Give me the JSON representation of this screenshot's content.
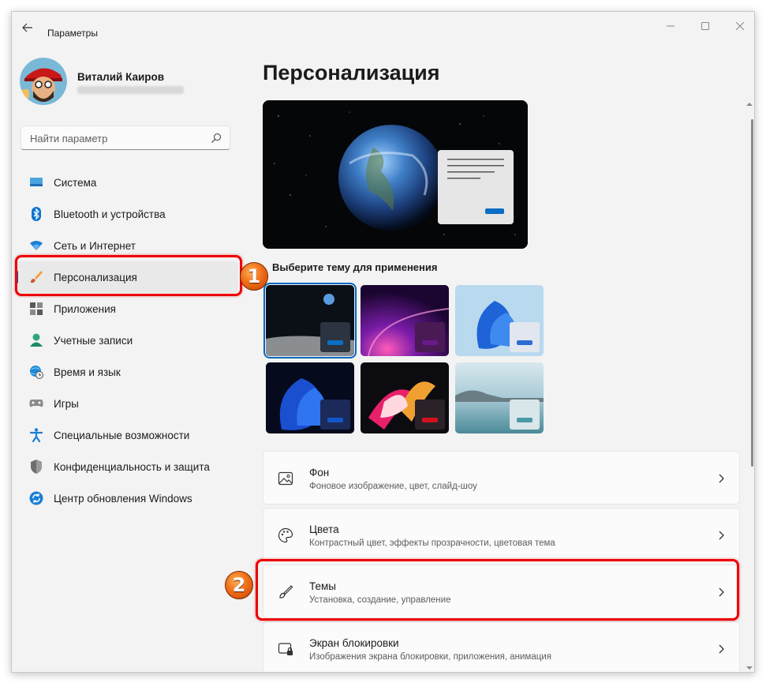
{
  "window": {
    "title": "Параметры"
  },
  "user": {
    "name": "Виталий Каиров"
  },
  "search": {
    "placeholder": "Найти параметр"
  },
  "nav": [
    {
      "label": "Система",
      "icon": "system-icon"
    },
    {
      "label": "Bluetooth и устройства",
      "icon": "bluetooth-icon"
    },
    {
      "label": "Сеть и Интернет",
      "icon": "wifi-icon"
    },
    {
      "label": "Персонализация",
      "icon": "brush-icon",
      "active": true
    },
    {
      "label": "Приложения",
      "icon": "apps-icon"
    },
    {
      "label": "Учетные записи",
      "icon": "account-icon"
    },
    {
      "label": "Время и язык",
      "icon": "globe-clock-icon"
    },
    {
      "label": "Игры",
      "icon": "gamepad-icon"
    },
    {
      "label": "Специальные возможности",
      "icon": "accessibility-icon"
    },
    {
      "label": "Конфиденциальность и защита",
      "icon": "shield-icon"
    },
    {
      "label": "Центр обновления Windows",
      "icon": "update-icon"
    }
  ],
  "main": {
    "title": "Персонализация",
    "choose_label": "Выберите тему для применения",
    "themes": [
      {
        "name": "earth-moon",
        "accent": "#0a6fc4",
        "selected": true
      },
      {
        "name": "glow-purple",
        "accent": "#6a1a8a"
      },
      {
        "name": "bloom-light",
        "accent": "#2a6fd0"
      },
      {
        "name": "bloom-dark",
        "accent": "#1257c9"
      },
      {
        "name": "captured-motion",
        "accent": "#d4101c"
      },
      {
        "name": "sunrise-lake",
        "accent": "#4a9aa8"
      }
    ],
    "cards": [
      {
        "title": "Фон",
        "subtitle": "Фоновое изображение, цвет, слайд-шоу",
        "icon": "image-icon"
      },
      {
        "title": "Цвета",
        "subtitle": "Контрастный цвет, эффекты прозрачности, цветовая тема",
        "icon": "palette-icon"
      },
      {
        "title": "Темы",
        "subtitle": "Установка, создание, управление",
        "icon": "brush-icon"
      },
      {
        "title": "Экран блокировки",
        "subtitle": "Изображения экрана блокировки, приложения, анимация",
        "icon": "lock-screen-icon"
      }
    ]
  },
  "annotations": {
    "badge1": "1",
    "badge2": "2"
  },
  "colors": {
    "accent": "#005fb8",
    "annotation": "#e00000",
    "background": "#f3f3f3"
  }
}
